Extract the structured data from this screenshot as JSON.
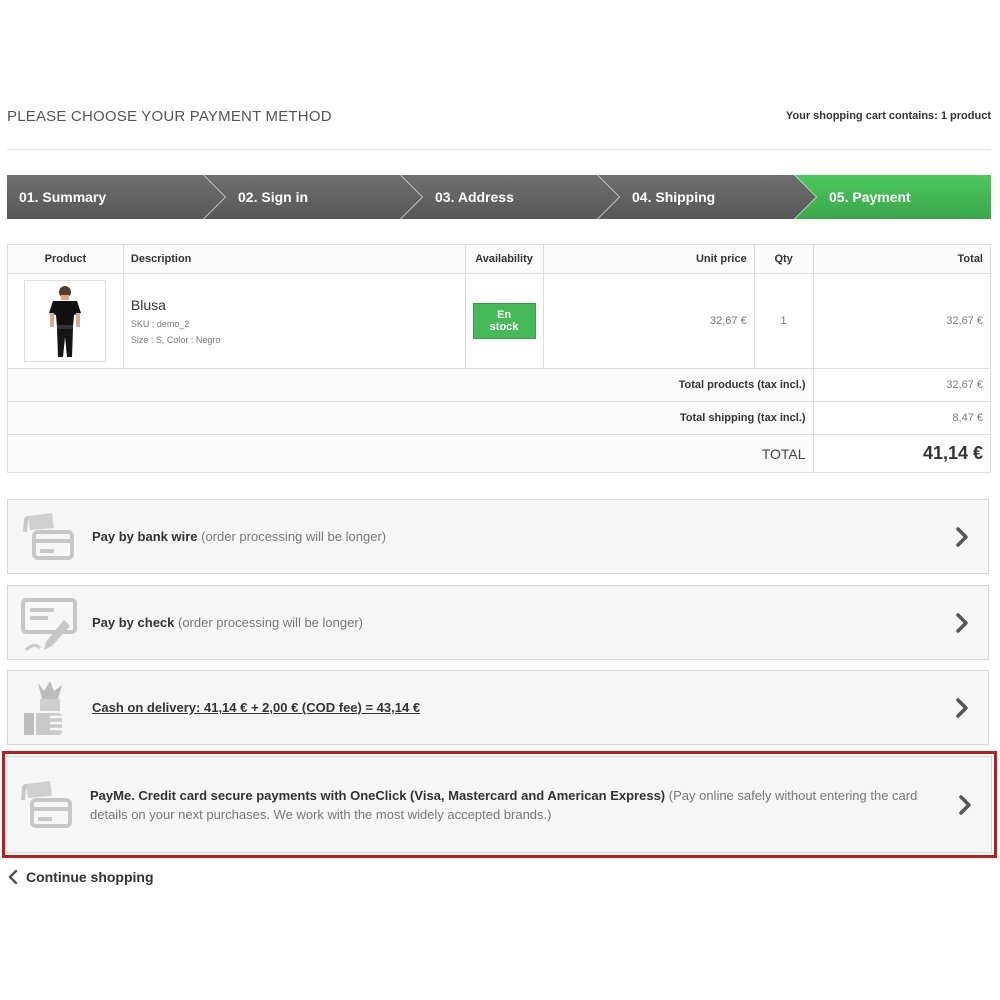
{
  "page": {
    "heading": "PLEASE CHOOSE YOUR PAYMENT METHOD",
    "cart_summary": "Your shopping cart contains: 1 product"
  },
  "steps": [
    {
      "label": "01. Summary",
      "active": false
    },
    {
      "label": "02. Sign in",
      "active": false
    },
    {
      "label": "03. Address",
      "active": false
    },
    {
      "label": "04. Shipping",
      "active": false
    },
    {
      "label": "05. Payment",
      "active": true
    }
  ],
  "table": {
    "headers": {
      "product": "Product",
      "description": "Description",
      "availability": "Availability",
      "unit_price": "Unit price",
      "qty": "Qty",
      "total": "Total"
    },
    "item": {
      "name": "Blusa",
      "sku": "SKU : demo_2",
      "attributes": "Size : S, Color : Negro",
      "availability": "En stock",
      "unit_price": "32,67 €",
      "qty": "1",
      "total": "32,67 €"
    },
    "total_products_label": "Total products (tax incl.)",
    "total_products_value": "32,67 €",
    "total_shipping_label": "Total shipping (tax incl.)",
    "total_shipping_value": "8,47 €",
    "total_label": "TOTAL",
    "total_value": "41,14 €"
  },
  "payments": {
    "bankwire": {
      "title": "Pay by bank wire",
      "note": "(order processing will be longer)",
      "icon": "bankwire-card-icon"
    },
    "check": {
      "title": "Pay by check",
      "note": "(order processing will be longer)",
      "icon": "check-icon"
    },
    "cod": {
      "text": "Cash on delivery: 41,14 € + 2,00 € (COD fee) = 43,14 €",
      "icon": "cash-hand-icon"
    },
    "payme": {
      "title": "PayMe. Credit card secure payments with OneClick (Visa, Mastercard and American Express)",
      "note": "(Pay online safely without entering the card details on your next purchases. We work with the most widely accepted brands.)",
      "icon": "credit-card-icon"
    }
  },
  "continue_label": "Continue shopping",
  "colors": {
    "step_active": "#46b958",
    "step_inactive": "#606060",
    "highlight_border": "#c11b1b",
    "stock_badge": "#46b958"
  }
}
